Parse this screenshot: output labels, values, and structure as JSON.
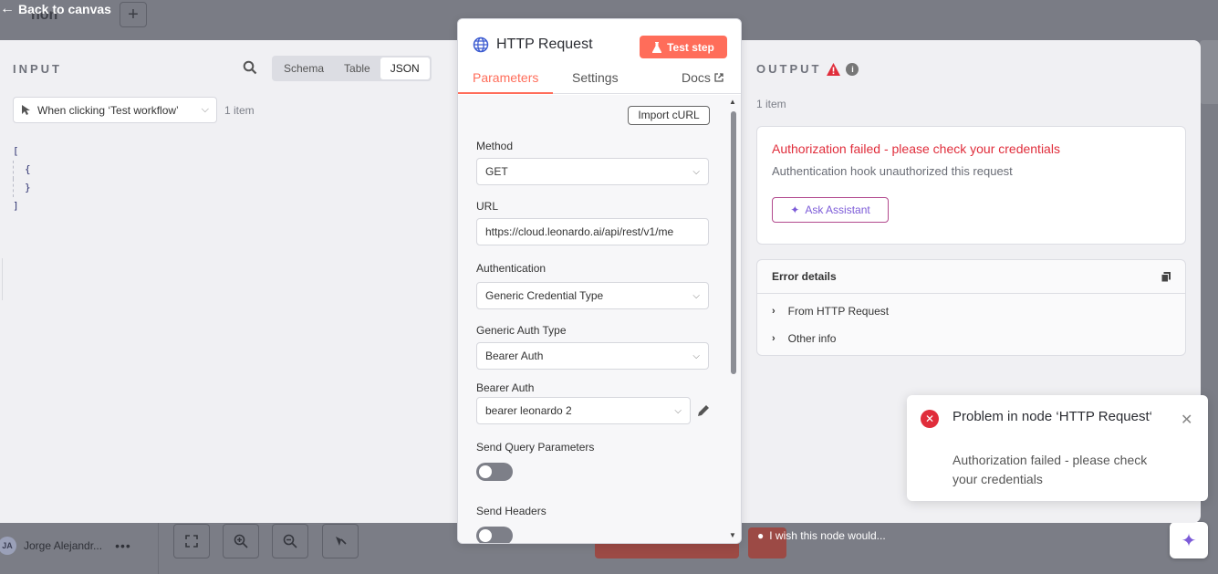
{
  "canvas": {
    "back_link": "Back to canvas",
    "workflow_name": "non",
    "plus_label": "+",
    "user_initials": "JA",
    "user_name": "Jorge Alejandr...",
    "user_menu": "•••",
    "wish_text": "I wish this node would..."
  },
  "input": {
    "title": "INPUT",
    "views": [
      "Schema",
      "Table",
      "JSON"
    ],
    "active_view": "JSON",
    "trigger": "When clicking ‘Test workflow’",
    "item_count": "1 item",
    "json_lines": [
      "[",
      "{",
      "}",
      "]"
    ]
  },
  "node": {
    "title": "HTTP Request",
    "test_step": "Test step",
    "tabs": [
      "Parameters",
      "Settings",
      "Docs"
    ],
    "active_tab": "Parameters",
    "import_curl": "Import cURL",
    "method_label": "Method",
    "method_value": "GET",
    "url_label": "URL",
    "url_value": "https://cloud.leonardo.ai/api/rest/v1/me",
    "auth_label": "Authentication",
    "auth_value": "Generic Credential Type",
    "generic_auth_label": "Generic Auth Type",
    "generic_auth_value": "Bearer Auth",
    "bearer_label": "Bearer Auth",
    "bearer_value": "bearer leonardo 2",
    "query_label": "Send Query Parameters",
    "query_enabled": false,
    "headers_label": "Send Headers",
    "headers_enabled": false
  },
  "output": {
    "title": "OUTPUT",
    "item_count": "1 item",
    "error_title": "Authorization failed - please check your credentials",
    "error_desc": "Authentication hook unauthorized this request",
    "ask_assistant": "Ask Assistant",
    "details_title": "Error details",
    "details_rows": [
      "From HTTP Request",
      "Other info"
    ]
  },
  "toast": {
    "title": "Problem in node ‘HTTP Request‘",
    "message": "Authorization failed - please check your credentials"
  },
  "colors": {
    "accent": "#ff6d5a",
    "error": "#e02d3b",
    "assistant": "#7c5bd8"
  }
}
